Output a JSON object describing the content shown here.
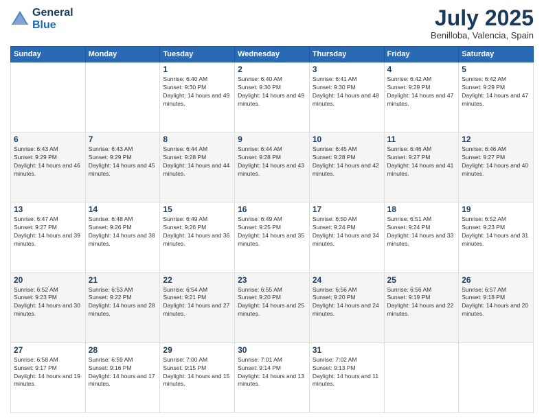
{
  "header": {
    "logo_general": "General",
    "logo_blue": "Blue",
    "month_title": "July 2025",
    "location": "Benilloba, Valencia, Spain"
  },
  "days_of_week": [
    "Sunday",
    "Monday",
    "Tuesday",
    "Wednesday",
    "Thursday",
    "Friday",
    "Saturday"
  ],
  "weeks": [
    [
      {
        "day": "",
        "info": ""
      },
      {
        "day": "",
        "info": ""
      },
      {
        "day": "1",
        "info": "Sunrise: 6:40 AM\nSunset: 9:30 PM\nDaylight: 14 hours and 49 minutes."
      },
      {
        "day": "2",
        "info": "Sunrise: 6:40 AM\nSunset: 9:30 PM\nDaylight: 14 hours and 49 minutes."
      },
      {
        "day": "3",
        "info": "Sunrise: 6:41 AM\nSunset: 9:30 PM\nDaylight: 14 hours and 48 minutes."
      },
      {
        "day": "4",
        "info": "Sunrise: 6:42 AM\nSunset: 9:29 PM\nDaylight: 14 hours and 47 minutes."
      },
      {
        "day": "5",
        "info": "Sunrise: 6:42 AM\nSunset: 9:29 PM\nDaylight: 14 hours and 47 minutes."
      }
    ],
    [
      {
        "day": "6",
        "info": "Sunrise: 6:43 AM\nSunset: 9:29 PM\nDaylight: 14 hours and 46 minutes."
      },
      {
        "day": "7",
        "info": "Sunrise: 6:43 AM\nSunset: 9:29 PM\nDaylight: 14 hours and 45 minutes."
      },
      {
        "day": "8",
        "info": "Sunrise: 6:44 AM\nSunset: 9:28 PM\nDaylight: 14 hours and 44 minutes."
      },
      {
        "day": "9",
        "info": "Sunrise: 6:44 AM\nSunset: 9:28 PM\nDaylight: 14 hours and 43 minutes."
      },
      {
        "day": "10",
        "info": "Sunrise: 6:45 AM\nSunset: 9:28 PM\nDaylight: 14 hours and 42 minutes."
      },
      {
        "day": "11",
        "info": "Sunrise: 6:46 AM\nSunset: 9:27 PM\nDaylight: 14 hours and 41 minutes."
      },
      {
        "day": "12",
        "info": "Sunrise: 6:46 AM\nSunset: 9:27 PM\nDaylight: 14 hours and 40 minutes."
      }
    ],
    [
      {
        "day": "13",
        "info": "Sunrise: 6:47 AM\nSunset: 9:27 PM\nDaylight: 14 hours and 39 minutes."
      },
      {
        "day": "14",
        "info": "Sunrise: 6:48 AM\nSunset: 9:26 PM\nDaylight: 14 hours and 38 minutes."
      },
      {
        "day": "15",
        "info": "Sunrise: 6:49 AM\nSunset: 9:26 PM\nDaylight: 14 hours and 36 minutes."
      },
      {
        "day": "16",
        "info": "Sunrise: 6:49 AM\nSunset: 9:25 PM\nDaylight: 14 hours and 35 minutes."
      },
      {
        "day": "17",
        "info": "Sunrise: 6:50 AM\nSunset: 9:24 PM\nDaylight: 14 hours and 34 minutes."
      },
      {
        "day": "18",
        "info": "Sunrise: 6:51 AM\nSunset: 9:24 PM\nDaylight: 14 hours and 33 minutes."
      },
      {
        "day": "19",
        "info": "Sunrise: 6:52 AM\nSunset: 9:23 PM\nDaylight: 14 hours and 31 minutes."
      }
    ],
    [
      {
        "day": "20",
        "info": "Sunrise: 6:52 AM\nSunset: 9:23 PM\nDaylight: 14 hours and 30 minutes."
      },
      {
        "day": "21",
        "info": "Sunrise: 6:53 AM\nSunset: 9:22 PM\nDaylight: 14 hours and 28 minutes."
      },
      {
        "day": "22",
        "info": "Sunrise: 6:54 AM\nSunset: 9:21 PM\nDaylight: 14 hours and 27 minutes."
      },
      {
        "day": "23",
        "info": "Sunrise: 6:55 AM\nSunset: 9:20 PM\nDaylight: 14 hours and 25 minutes."
      },
      {
        "day": "24",
        "info": "Sunrise: 6:56 AM\nSunset: 9:20 PM\nDaylight: 14 hours and 24 minutes."
      },
      {
        "day": "25",
        "info": "Sunrise: 6:56 AM\nSunset: 9:19 PM\nDaylight: 14 hours and 22 minutes."
      },
      {
        "day": "26",
        "info": "Sunrise: 6:57 AM\nSunset: 9:18 PM\nDaylight: 14 hours and 20 minutes."
      }
    ],
    [
      {
        "day": "27",
        "info": "Sunrise: 6:58 AM\nSunset: 9:17 PM\nDaylight: 14 hours and 19 minutes."
      },
      {
        "day": "28",
        "info": "Sunrise: 6:59 AM\nSunset: 9:16 PM\nDaylight: 14 hours and 17 minutes."
      },
      {
        "day": "29",
        "info": "Sunrise: 7:00 AM\nSunset: 9:15 PM\nDaylight: 14 hours and 15 minutes."
      },
      {
        "day": "30",
        "info": "Sunrise: 7:01 AM\nSunset: 9:14 PM\nDaylight: 14 hours and 13 minutes."
      },
      {
        "day": "31",
        "info": "Sunrise: 7:02 AM\nSunset: 9:13 PM\nDaylight: 14 hours and 11 minutes."
      },
      {
        "day": "",
        "info": ""
      },
      {
        "day": "",
        "info": ""
      }
    ]
  ]
}
